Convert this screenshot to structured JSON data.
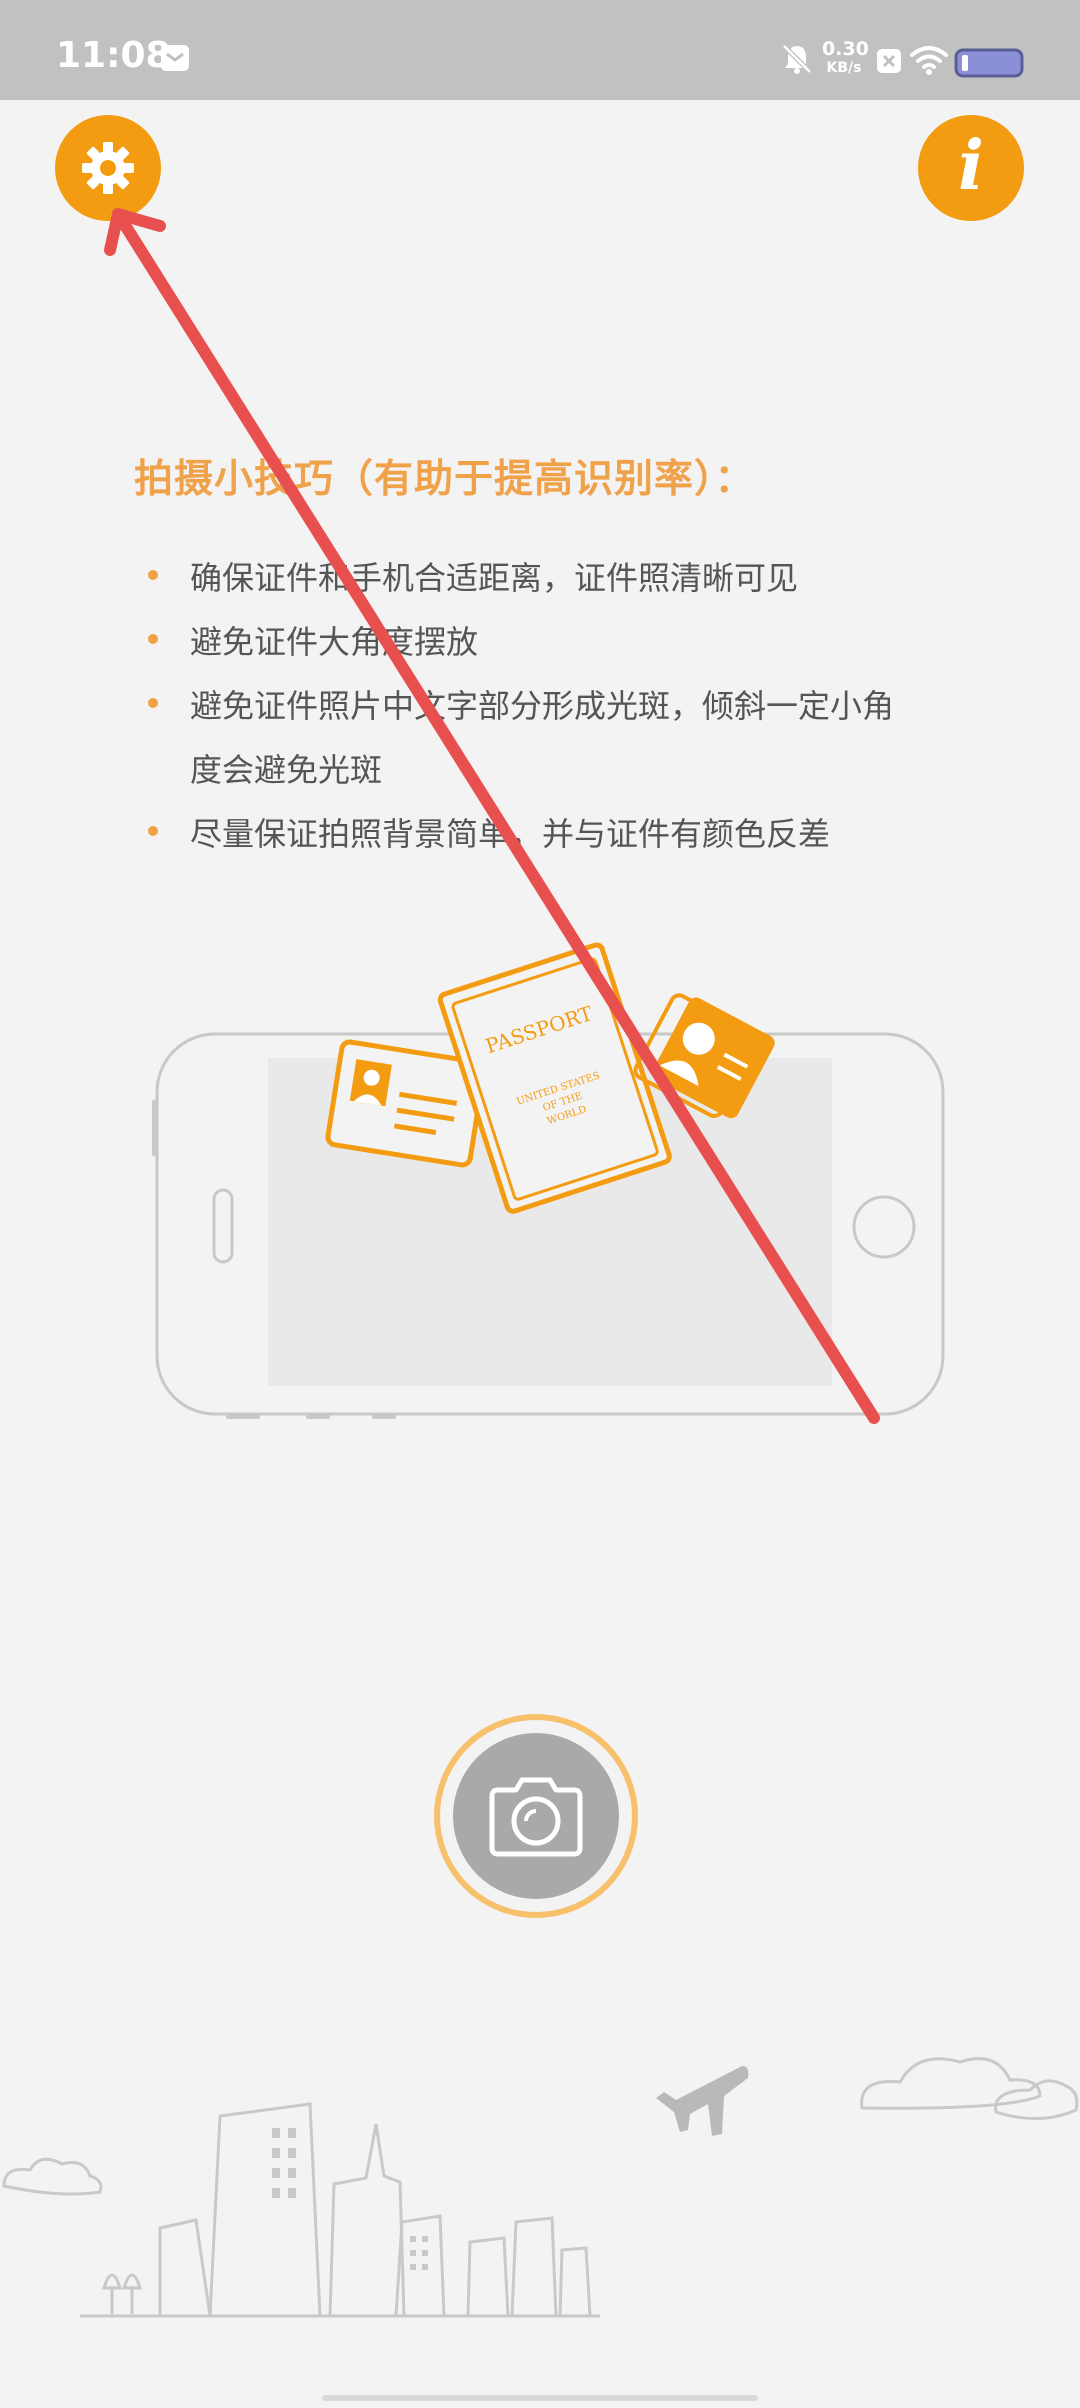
{
  "status_bar": {
    "time": "11:08",
    "net_speed_value": "0.30",
    "net_speed_unit": "KB/s",
    "icons": [
      "mail-icon",
      "bell-muted-icon",
      "x-box-icon",
      "wifi-icon",
      "battery-icon"
    ]
  },
  "toolbar": {
    "settings_icon": "gear-icon",
    "info_label": "i"
  },
  "tips": {
    "title": "拍摄小技巧（有助于提高识别率）：",
    "items": [
      "确保证件和手机合适距离，证件照清晰可见",
      "避免证件大角度摆放",
      "避免证件照片中文字部分形成光斑，倾斜一定小角度会避免光斑",
      "尽量保证拍照背景简单，并与证件有颜色反差"
    ]
  },
  "illustration": {
    "passport_title": "PASSPORT",
    "passport_line1": "UNITED STATES",
    "passport_line2": "OF THE",
    "passport_line3": "WORLD"
  },
  "capture": {
    "icon": "camera-icon"
  },
  "colors": {
    "accent": "#f39c12",
    "tip_text": "#555555",
    "status_bar": "#c1c1c1",
    "annotation_arrow": "#e8504f"
  }
}
